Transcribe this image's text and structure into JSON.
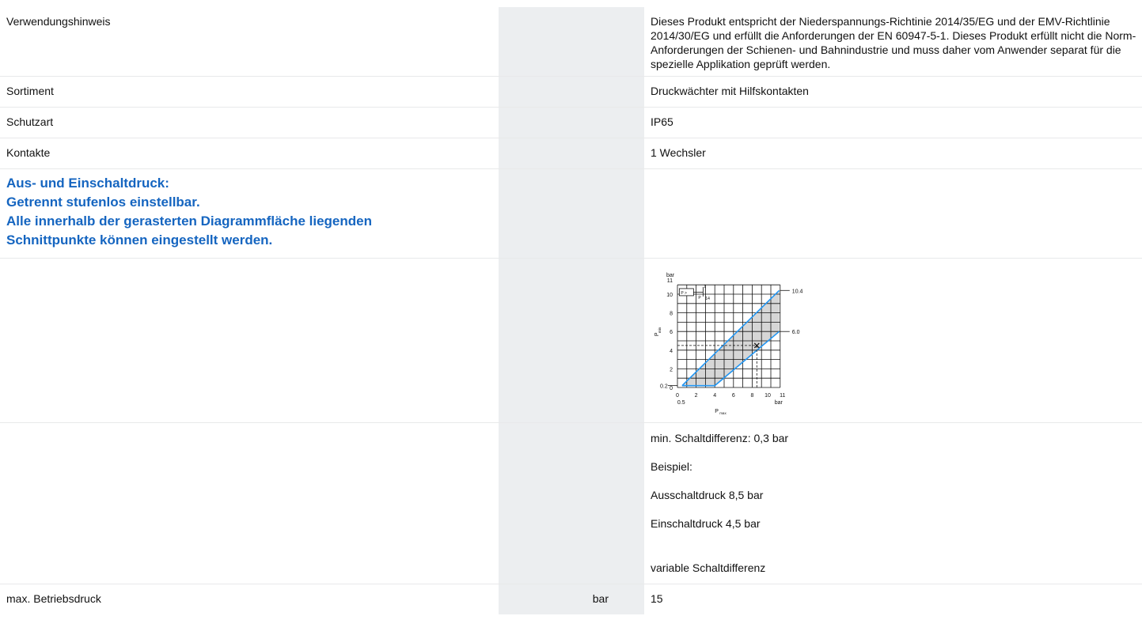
{
  "rows": {
    "usage": {
      "label": "Verwendungshinweis",
      "value": "Dieses Produkt entspricht der Niederspannungs-Richtinie 2014/35/EG und der EMV-Richtlinie 2014/30/EG und erfüllt die Anforderungen der EN 60947-5-1. Dieses Produkt erfüllt nicht die Norm-Anforderungen der Schienen- und Bahnindustrie und muss daher vom Anwender separat für die spezielle Applikation geprüft werden."
    },
    "range": {
      "label": "Sortiment",
      "value": "Druckwächter mit Hilfskontakten"
    },
    "protection": {
      "label": "Schutzart",
      "value": "IP65"
    },
    "contacts": {
      "label": "Kontakte",
      "value": "1 Wechsler"
    },
    "note": {
      "line1": "Aus- und Einschaltdruck:",
      "line2": "Getrennt stufenlos einstellbar.",
      "line3": "Alle innerhalb der gerasterten Diagrammfläche liegenden",
      "line4": "Schnittpunkte können eingestellt werden."
    },
    "example": {
      "p1": "min. Schaltdifferenz: 0,3 bar",
      "p2": "Beispiel:",
      "p3": "Ausschaltdruck 8,5 bar",
      "p4": "Einschaltdruck 4,5 bar"
    },
    "variable": {
      "value": "variable Schaltdifferenz"
    },
    "max_pressure": {
      "label": "max. Betriebsdruck",
      "unit": "bar",
      "value": "15"
    }
  },
  "diagram": {
    "y_unit": "bar",
    "y_axis_label": "P",
    "y_axis_sub": "min",
    "x_axis_label": "P",
    "x_axis_sub": "max",
    "x_unit": "bar",
    "y_ticks": [
      "0",
      "2",
      "4",
      "6",
      "8",
      "10",
      "11"
    ],
    "x_ticks": [
      "0",
      "2",
      "4",
      "6",
      "8",
      "10",
      "11"
    ],
    "x_extra_tick": "0.5",
    "y_extra_tick": "0.2",
    "upper_line_label": "10.4",
    "lower_line_label": "6.0",
    "symbol_text": "P >",
    "symbol_sub1": "P",
    "symbol_sub2": "14",
    "symbol_sup": "1",
    "accent_color": "#2196f3",
    "shade_color": "#d6d6d6"
  },
  "chart_data": {
    "type": "area",
    "xlabel": "P max",
    "ylabel": "P min",
    "xlim": [
      0,
      11
    ],
    "ylim": [
      0,
      11
    ],
    "grid": true,
    "series": [
      {
        "name": "10.4",
        "x": [
          0.5,
          10.9
        ],
        "y": [
          0.2,
          10.4
        ]
      },
      {
        "name": "6.0",
        "x": [
          0.5,
          4,
          10.9
        ],
        "y": [
          0.2,
          0.2,
          6.0
        ]
      }
    ],
    "example_point": {
      "x": 8.5,
      "y": 4.5
    }
  }
}
